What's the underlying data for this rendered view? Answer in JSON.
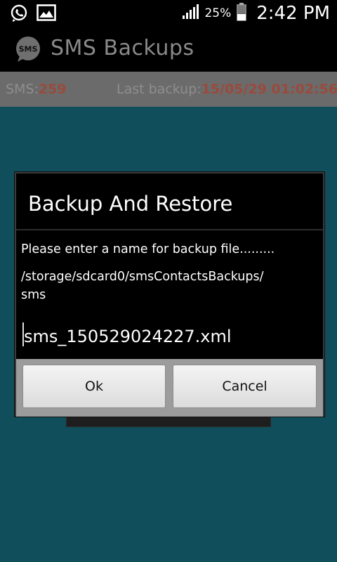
{
  "status_bar": {
    "battery_percent": "25%",
    "time": "2:42 PM",
    "icons": [
      "whatsapp-icon",
      "gallery-icon",
      "signal-icon",
      "battery-icon"
    ]
  },
  "app": {
    "title": "SMS Backups",
    "logo_text": "SMS"
  },
  "info_bar": {
    "sms_label": "SMS:",
    "sms_count": "259",
    "last_backup_label": "Last backup:",
    "last_backup_value": "15/05/29 01:02:56"
  },
  "dialog": {
    "title": "Backup And Restore",
    "message": "Please enter a name for backup file.........",
    "path": "/storage/sdcard0/smsContactsBackups/\nsms",
    "filename_value": "sms_150529024227.xml",
    "ok_label": "Ok",
    "cancel_label": "Cancel"
  },
  "colors": {
    "background": "#0f4e5a",
    "info_value": "#9a4a3c"
  }
}
